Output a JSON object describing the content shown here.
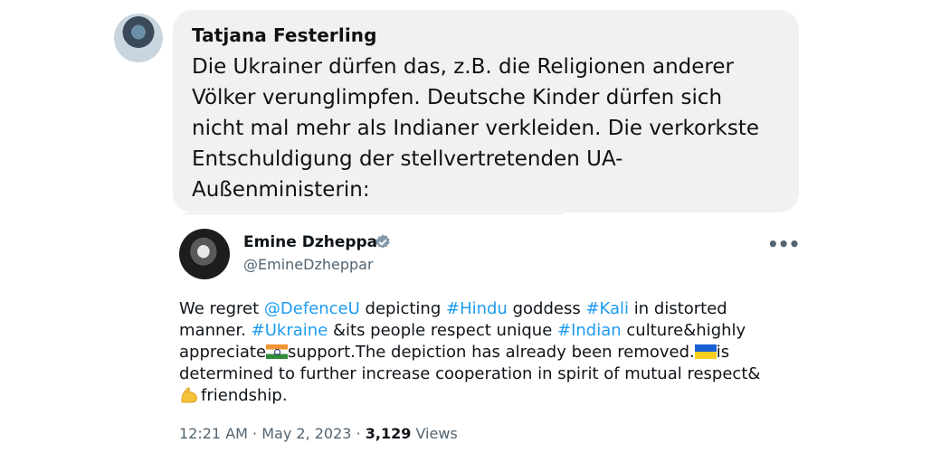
{
  "reply": {
    "author": "Tatjana Festerling",
    "message": "Die Ukrainer dürfen das, z.B. die Religionen anderer Völker verunglimpfen. Deutsche Kinder dürfen sich nicht mal mehr als Indianer verkleiden. Die verkorkste Entschuldigung der stellvertretenden UA-Außenministerin:"
  },
  "quoted_tweet": {
    "display_name": "Emine Dzheppar",
    "handle": "@EmineDzheppar",
    "body": {
      "t1": "We regret ",
      "mention": "@DefenceU",
      "t2": " depicting ",
      "tag_hindu": "#Hindu",
      "t3": " goddess ",
      "tag_kali": "#Kali",
      "t4": " in distorted manner. ",
      "tag_ukraine": "#Ukraine",
      "t5": " &its people respect unique ",
      "tag_indian": "#Indian",
      "t6": " culture&highly appreciate",
      "t7": "support.The depiction has already been removed.",
      "t8": "is determined to further increase cooperation in spirit of mutual respect&",
      "t9": "friendship."
    },
    "time": "12:21 AM",
    "date": "May 2, 2023",
    "separator": "·",
    "views_count": "3,129",
    "views_label": "Views",
    "more_label": "•••"
  },
  "colors": {
    "link": "#1d9bf0",
    "bubble_bg": "#f0f1f3",
    "muted_text": "#536471",
    "verified": "#829aab"
  },
  "icons": [
    "india-flag-icon",
    "ukraine-flag-icon",
    "flexed-biceps-icon",
    "verified-badge-icon",
    "more-options-icon"
  ]
}
